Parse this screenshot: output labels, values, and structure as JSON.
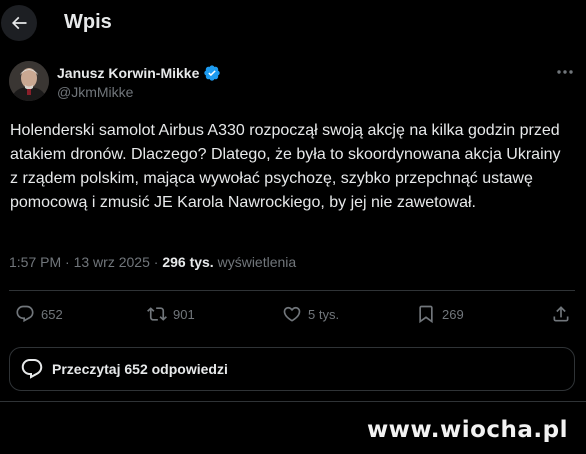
{
  "header": {
    "title": "Wpis",
    "back_icon": "arrow-left-icon"
  },
  "tweet": {
    "author_name": "Janusz Korwin-Mikke",
    "author_handle": "@JkmMikke",
    "verified_icon": "verified-badge-icon",
    "text": "Holenderski samolot Airbus A330 rozpoczął swoją akcję na kilka godzin przed atakiem dronów. Dlaczego? Dlatego, że była to skoordynowana akcja Ukrainy z rządem polskim, mająca wywołać psychozę, szybko przepchnąć ustawę pomocową i zmusić JE Karola Nawrockiego, by jej nie zawetował.",
    "time": "1:57 PM",
    "date": "13 wrz 2025",
    "views_count": "296 tys.",
    "views_label": "wyświetlenia"
  },
  "actions": {
    "replies": "652",
    "reposts": "901",
    "likes": "5 tys.",
    "bookmarks": "269"
  },
  "replies_button": {
    "label": "Przeczytaj 652 odpowiedzi"
  },
  "watermark": {
    "text": "www.wiocha.pl"
  },
  "colors": {
    "background": "#000000",
    "text": "#e7e9ea",
    "secondary": "#71767b",
    "verified": "#1d9bf0",
    "border": "#2f3336"
  }
}
